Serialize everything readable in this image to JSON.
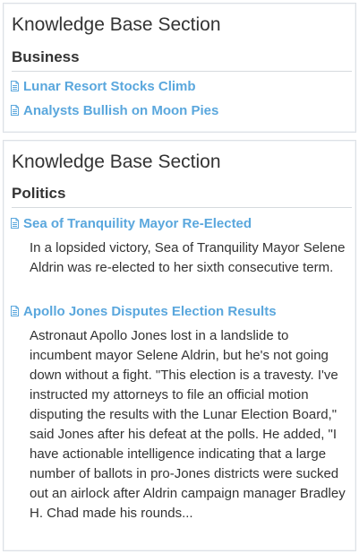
{
  "sections": [
    {
      "title": "Knowledge Base Section",
      "category": "Business",
      "articles": [
        {
          "title": "Lunar Resort Stocks Climb",
          "icon": "document-icon"
        },
        {
          "title": "Analysts Bullish on Moon Pies",
          "icon": "document-icon"
        }
      ]
    },
    {
      "title": "Knowledge Base Section",
      "category": "Politics",
      "articles": [
        {
          "title": "Sea of Tranquility Mayor Re-Elected",
          "icon": "document-icon",
          "summary": "In a lopsided victory, Sea of Tranquility Mayor Selene Aldrin was re-elected to her sixth consecutive term."
        },
        {
          "title": "Apollo Jones Disputes Election Results",
          "icon": "document-icon",
          "summary": "Astronaut Apollo Jones lost in a landslide to incumbent mayor Selene Aldrin, but he's not going down without a fight. \"This election is a travesty. I've instructed my attorneys to file an official motion disputing the results with the Lunar Election Board,\" said Jones after his defeat at the polls. He added, \"I have actionable intelligence indicating that a large number of ballots in pro-Jones districts were sucked out an airlock after Aldrin campaign manager Bradley H. Chad made his rounds..."
        }
      ]
    }
  ],
  "colors": {
    "link": "#5aa7dd",
    "text": "#333333",
    "border": "#dde1e6",
    "divider": "#d6dade"
  }
}
